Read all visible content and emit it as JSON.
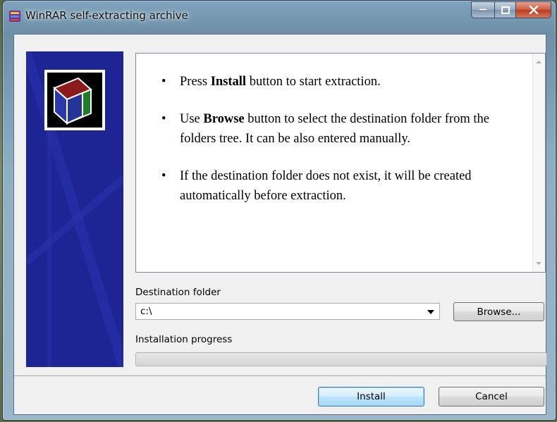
{
  "window": {
    "title": "WinRAR self-extracting archive",
    "accent": "#1d2494"
  },
  "content": {
    "bullets": [
      {
        "prefix": "Press ",
        "bold": "Install",
        "suffix": " button to start extraction."
      },
      {
        "prefix": "Use ",
        "bold": "Browse",
        "suffix": " button to select the destination folder from the folders tree. It can be also entered manually."
      },
      {
        "prefix": "",
        "bold": "",
        "suffix": "If the destination folder does not exist, it will be created automatically before extraction."
      }
    ]
  },
  "destination": {
    "label": "Destination folder",
    "value": "c:\\",
    "browse_label": "Browse..."
  },
  "progress": {
    "label": "Installation progress",
    "percent": 0
  },
  "buttons": {
    "install_label": "Install",
    "cancel_label": "Cancel"
  }
}
